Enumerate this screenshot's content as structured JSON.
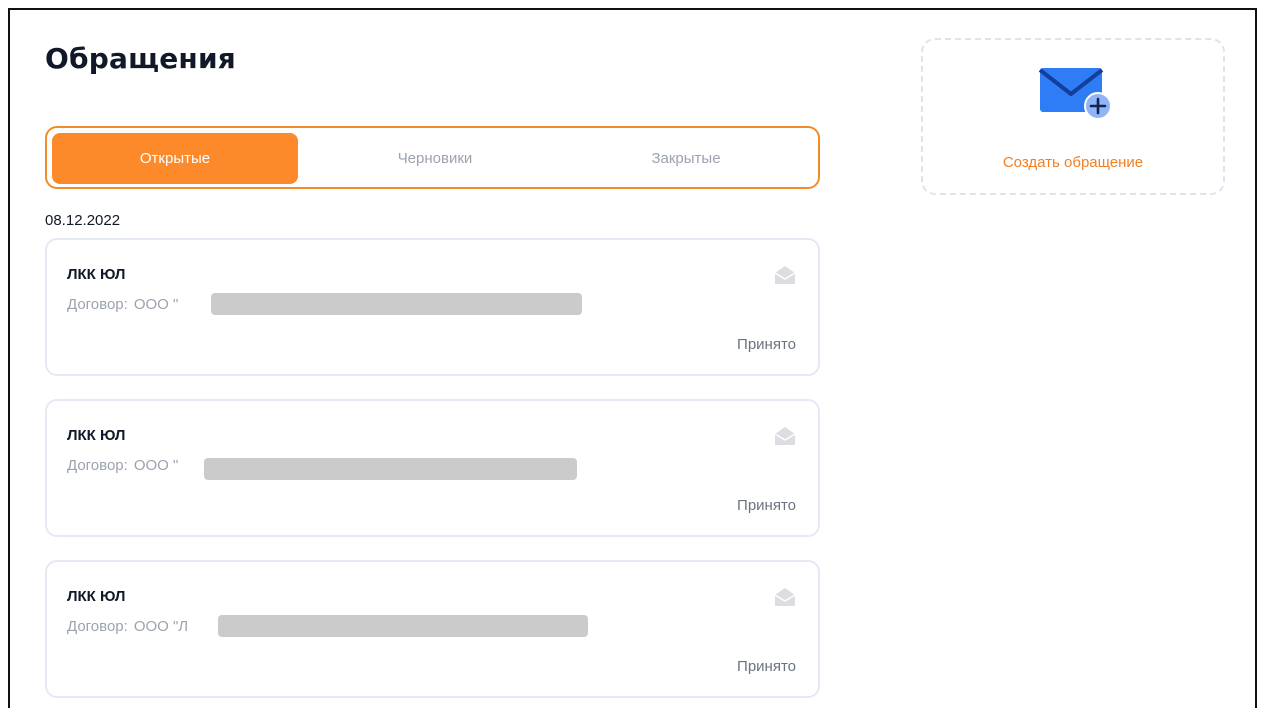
{
  "page": {
    "title": "Обращения"
  },
  "tabs": [
    {
      "label": "Открытые",
      "active": true
    },
    {
      "label": "Черновики",
      "active": false
    },
    {
      "label": "Закрытые",
      "active": false
    }
  ],
  "date_group": "08.12.2022",
  "tickets": [
    {
      "title": "ЛКК ЮЛ",
      "contract_label": "Договор:",
      "contract_value": "ООО \"",
      "status": "Принято"
    },
    {
      "title": "ЛКК ЮЛ",
      "contract_label": "Договор:",
      "contract_value": "ООО \"",
      "status": "Принято"
    },
    {
      "title": "ЛКК ЮЛ",
      "contract_label": "Договор:",
      "contract_value": "ООО \"Л",
      "status": "Принято"
    }
  ],
  "create": {
    "label": "Создать обращение"
  },
  "colors": {
    "accent": "#fd8a2a",
    "accent_text": "#f37f22",
    "envelope": "#2f7df6",
    "muted": "#9ca3af"
  }
}
